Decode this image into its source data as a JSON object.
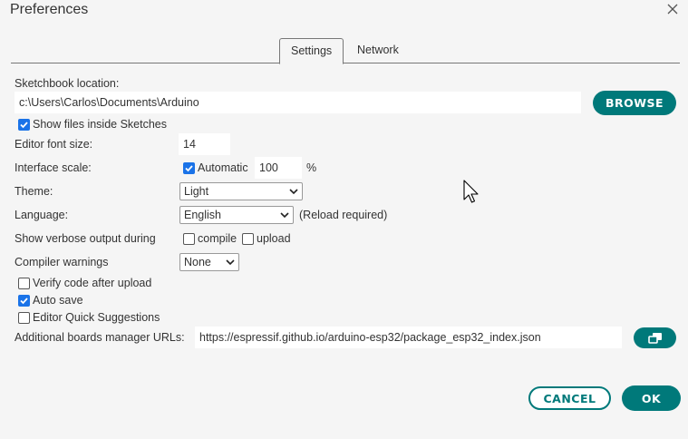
{
  "dialog": {
    "title": "Preferences"
  },
  "tabs": [
    {
      "label": "Settings"
    },
    {
      "label": "Network"
    }
  ],
  "sketchbook": {
    "label": "Sketchbook location:",
    "value": "c:\\Users\\Carlos\\Documents\\Arduino",
    "browse_label": "BROWSE"
  },
  "show_files": {
    "label": "Show files inside Sketches",
    "checked": true
  },
  "font_size": {
    "label": "Editor font size:",
    "value": "14"
  },
  "interface_scale": {
    "label": "Interface scale:",
    "automatic_label": "Automatic",
    "automatic_checked": true,
    "value": "100",
    "unit": "%"
  },
  "theme": {
    "label": "Theme:",
    "value": "Light"
  },
  "language": {
    "label": "Language:",
    "value": "English",
    "note": "(Reload required)"
  },
  "verbose": {
    "label": "Show verbose output during",
    "compile_label": "compile",
    "upload_label": "upload",
    "compile_checked": false,
    "upload_checked": false
  },
  "compiler_warnings": {
    "label": "Compiler warnings",
    "value": "None"
  },
  "verify": {
    "label": "Verify code after upload",
    "checked": false
  },
  "auto_save": {
    "label": "Auto save",
    "checked": true
  },
  "quick_suggestions": {
    "label": "Editor Quick Suggestions",
    "checked": false
  },
  "boards_urls": {
    "label": "Additional boards manager URLs:",
    "value": "https://espressif.github.io/arduino-esp32/package_esp32_index.json"
  },
  "footer": {
    "cancel_label": "CANCEL",
    "ok_label": "OK"
  },
  "colors": {
    "accent": "#00797a",
    "checkbox": "#1a73e8",
    "background": "#f5f5f5"
  }
}
